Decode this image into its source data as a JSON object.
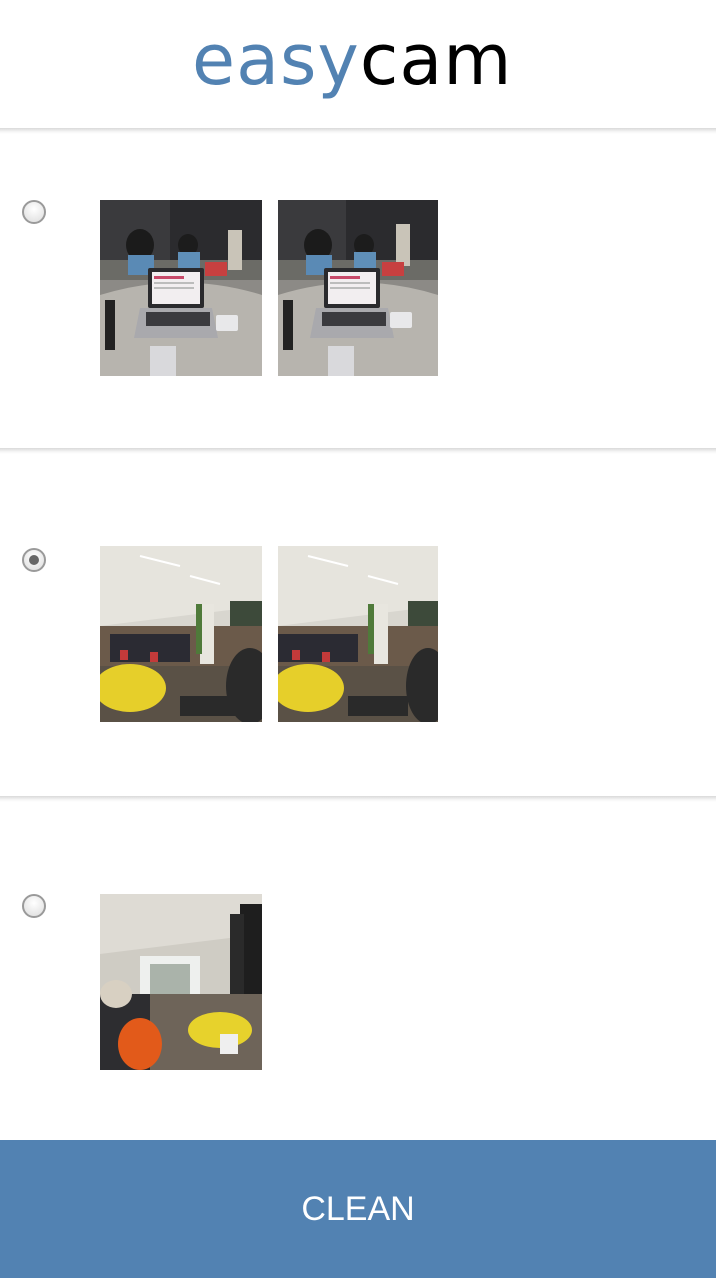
{
  "header": {
    "logo_part1": "easy",
    "logo_part2": "cam"
  },
  "groups": [
    {
      "selected": false,
      "photos": [
        "office-desk-laptop-photo",
        "office-desk-laptop-photo"
      ]
    },
    {
      "selected": true,
      "photos": [
        "hall-yellow-beanbag-photo",
        "hall-yellow-beanbag-photo"
      ]
    },
    {
      "selected": false,
      "photos": [
        "corridor-yellow-beanbag-photo"
      ]
    }
  ],
  "footer": {
    "clean_label": "CLEAN"
  },
  "colors": {
    "accent": "#5282b2",
    "logo_dark": "#000000"
  }
}
